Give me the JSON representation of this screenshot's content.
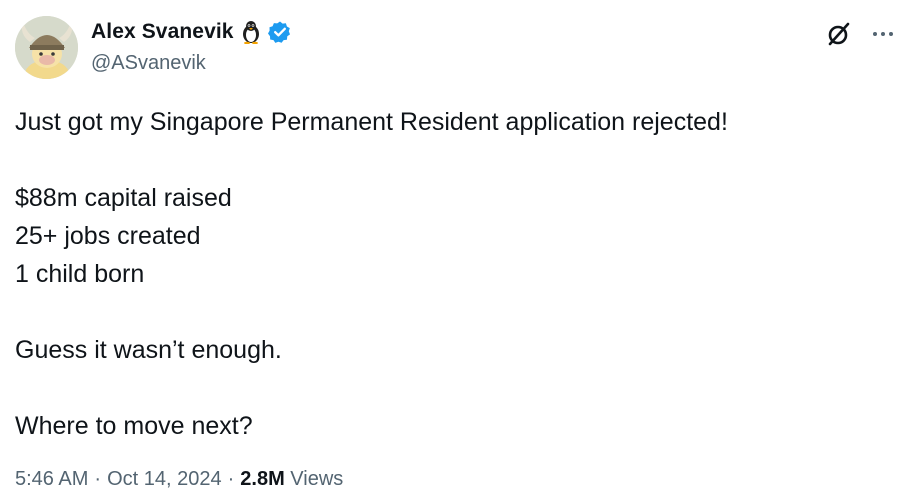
{
  "author": {
    "display_name": "Alex Svanevik",
    "emoji": "penguin-icon",
    "verified": true,
    "handle": "@ASvanevik"
  },
  "tweet": {
    "lines": [
      "Just got my Singapore Permanent Resident application rejected!",
      "",
      "$88m capital raised",
      "25+ jobs created",
      "1 child born",
      "",
      "Guess it wasn’t enough.",
      "",
      "Where to move next?"
    ]
  },
  "meta": {
    "time": "5:46 AM",
    "separator": "·",
    "date": "Oct 14, 2024",
    "views_count": "2.8M",
    "views_label": "Views"
  },
  "colors": {
    "text": "#0f1419",
    "secondary": "#536471",
    "verified": "#1d9bf0"
  },
  "icons": {
    "grok": "grok-icon",
    "more": "more-icon"
  }
}
